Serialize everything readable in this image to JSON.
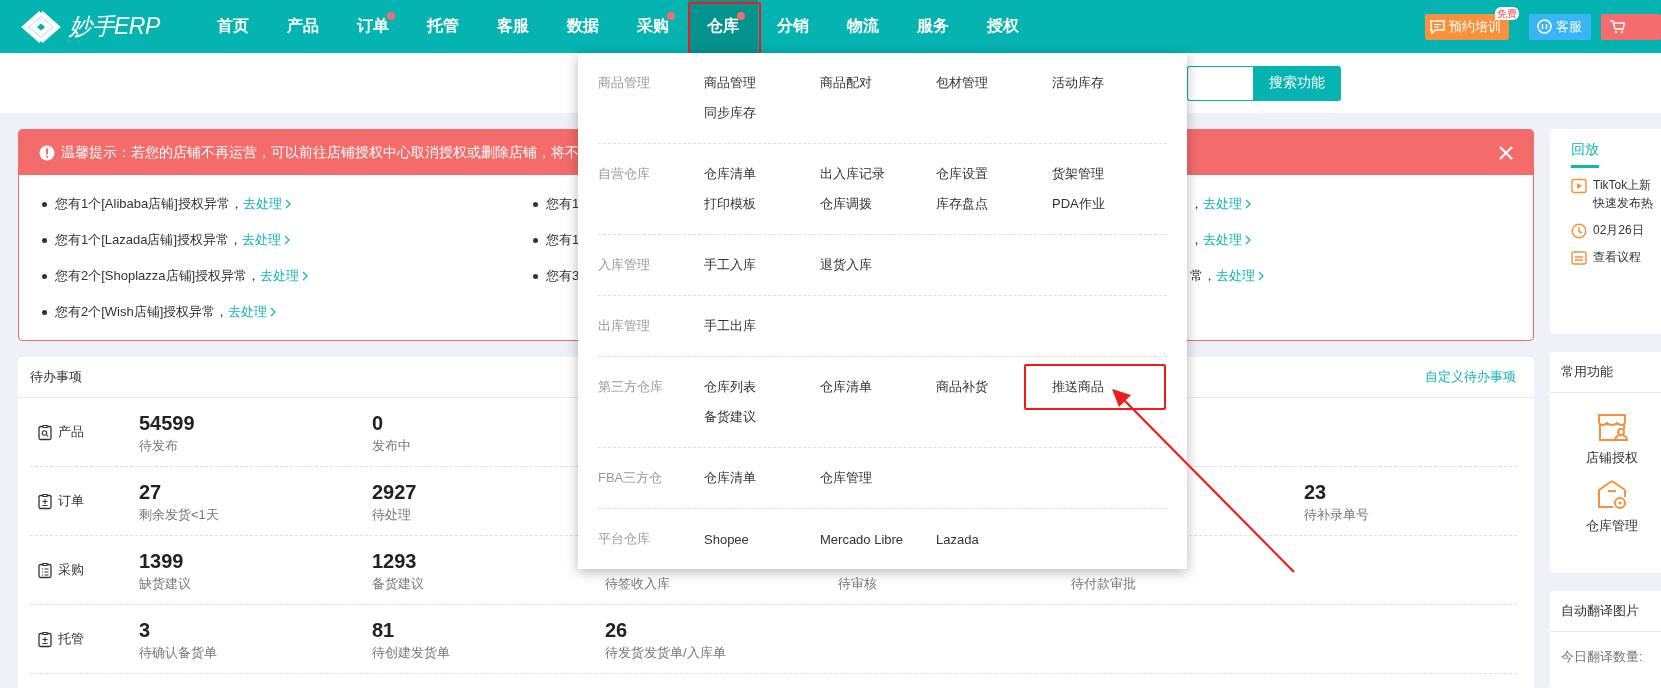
{
  "header": {
    "logo": "妙手ERP",
    "nav": [
      {
        "label": "首页",
        "selected": false,
        "dot": false,
        "highlighted": false
      },
      {
        "label": "产品",
        "selected": false,
        "dot": false,
        "highlighted": false
      },
      {
        "label": "订单",
        "selected": false,
        "dot": true,
        "highlighted": false
      },
      {
        "label": "托管",
        "selected": false,
        "dot": false,
        "highlighted": false
      },
      {
        "label": "客服",
        "selected": false,
        "dot": false,
        "highlighted": false
      },
      {
        "label": "数据",
        "selected": false,
        "dot": false,
        "highlighted": false
      },
      {
        "label": "采购",
        "selected": false,
        "dot": true,
        "highlighted": false
      },
      {
        "label": "仓库",
        "selected": true,
        "dot": true,
        "highlighted": true
      },
      {
        "label": "分销",
        "selected": false,
        "dot": false,
        "highlighted": false
      },
      {
        "label": "物流",
        "selected": false,
        "dot": false,
        "highlighted": false
      },
      {
        "label": "服务",
        "selected": false,
        "dot": false,
        "highlighted": false
      },
      {
        "label": "授权",
        "selected": false,
        "dot": false,
        "highlighted": false
      }
    ],
    "actions": [
      {
        "kind": "training",
        "label": "预约培训",
        "badge": "免费"
      },
      {
        "kind": "service",
        "label": "客服"
      },
      {
        "kind": "cart"
      }
    ]
  },
  "search": {
    "button": "搜索功能"
  },
  "notice": {
    "message": "温馨提示：若您的店铺不再运营，可以前往店铺授权中心取消授权或删除店铺，将不",
    "columns": [
      {
        "bullets": true,
        "items": [
          {
            "text": "您有1个[Alibaba店铺]授权异常，",
            "link": "去处理"
          },
          {
            "text": "您有1个[Lazada店铺]授权异常，",
            "link": "去处理"
          },
          {
            "text": "您有2个[Shoplazza店铺]授权异常，",
            "link": "去处理"
          },
          {
            "text": "您有2个[Wish店铺]授权异常，",
            "link": "去处理"
          }
        ]
      },
      {
        "bullets": true,
        "items": [
          {
            "text": "您有1"
          },
          {
            "text": "您有1"
          },
          {
            "text": "您有3"
          }
        ]
      },
      {
        "bullets": false,
        "items": [
          {
            "text": "，",
            "link": "去处理"
          },
          {
            "text": "，",
            "link": "去处理"
          },
          {
            "text": "常，",
            "link": "去处理"
          }
        ]
      }
    ]
  },
  "todo": {
    "title": "待办事项",
    "customize": "自定义待办事项",
    "rows": [
      {
        "label": "产品",
        "kind": "search",
        "cells": [
          {
            "value": "54599",
            "label": "待发布"
          },
          {
            "value": "0",
            "label": "发布中"
          },
          null,
          null,
          null,
          null
        ]
      },
      {
        "label": "订单",
        "kind": "plus",
        "cells": [
          {
            "value": "27",
            "label": "剩余发货<1天"
          },
          {
            "value": "2927",
            "label": "待处理"
          },
          null,
          null,
          null,
          {
            "value": "23",
            "label": "待补录单号"
          }
        ]
      },
      {
        "label": "采购",
        "kind": "list",
        "cells": [
          {
            "value": "1399",
            "label": "缺货建议"
          },
          {
            "value": "1293",
            "label": "备货建议"
          },
          {
            "label": "待签收入库"
          },
          {
            "label": "待审核"
          },
          {
            "label": "待付款审批"
          },
          null
        ]
      },
      {
        "label": "托管",
        "kind": "plus",
        "cells": [
          {
            "value": "3",
            "label": "待确认备货单"
          },
          {
            "value": "81",
            "label": "待创建发货单"
          },
          {
            "value": "26",
            "label": "待发货发货单/入库单"
          },
          null,
          null,
          null
        ]
      }
    ]
  },
  "menu": {
    "sections": [
      {
        "title": "商品管理",
        "items": [
          {
            "label": "商品管理",
            "highlighted": false
          },
          {
            "label": "商品配对",
            "highlighted": false
          },
          {
            "label": "包材管理",
            "highlighted": false
          },
          {
            "label": "活动库存",
            "highlighted": false
          },
          {
            "label": "同步库存",
            "highlighted": false
          }
        ]
      },
      {
        "title": "自营仓库",
        "items": [
          {
            "label": "仓库清单",
            "highlighted": false
          },
          {
            "label": "出入库记录",
            "highlighted": false
          },
          {
            "label": "仓库设置",
            "highlighted": false
          },
          {
            "label": "货架管理",
            "highlighted": false
          },
          {
            "label": "打印模板",
            "highlighted": false
          },
          {
            "label": "仓库调拨",
            "highlighted": false
          },
          {
            "label": "库存盘点",
            "highlighted": false
          },
          {
            "label": "PDA作业",
            "highlighted": false
          }
        ]
      },
      {
        "title": "入库管理",
        "items": [
          {
            "label": "手工入库",
            "highlighted": false
          },
          {
            "label": "退货入库",
            "highlighted": false
          }
        ]
      },
      {
        "title": "出库管理",
        "items": [
          {
            "label": "手工出库",
            "highlighted": false
          }
        ]
      },
      {
        "title": "第三方仓库",
        "items": [
          {
            "label": "仓库列表",
            "highlighted": false
          },
          {
            "label": "仓库清单",
            "highlighted": false
          },
          {
            "label": "商品补货",
            "highlighted": false
          },
          {
            "label": "推送商品",
            "highlighted": true
          },
          {
            "label": "备货建议",
            "highlighted": false
          }
        ]
      },
      {
        "title": "FBA三方仓",
        "items": [
          {
            "label": "仓库清单",
            "highlighted": false
          },
          {
            "label": "仓库管理",
            "highlighted": false
          }
        ]
      },
      {
        "title": "平台仓库",
        "items": [
          {
            "label": "Shopee",
            "highlighted": false
          },
          {
            "label": "Mercado Libre",
            "highlighted": false
          },
          {
            "label": "Lazada",
            "highlighted": false
          }
        ]
      }
    ]
  },
  "side": {
    "replay": {
      "tab": "回放",
      "items": [
        {
          "kind": "video",
          "lines": [
            "TikTok上新",
            "快速发布热"
          ]
        },
        {
          "kind": "time",
          "lines": [
            "02月26日"
          ]
        },
        {
          "kind": "agenda",
          "lines": [
            "查看议程"
          ]
        }
      ]
    },
    "shortcuts": {
      "title": "常用功能",
      "items": [
        {
          "kind": "store",
          "label": "店铺授权"
        },
        {
          "kind": "warehouse",
          "label": "仓库管理"
        }
      ]
    },
    "translate": {
      "title": "自动翻译图片",
      "lines": [
        "今日翻译数量:"
      ]
    }
  }
}
